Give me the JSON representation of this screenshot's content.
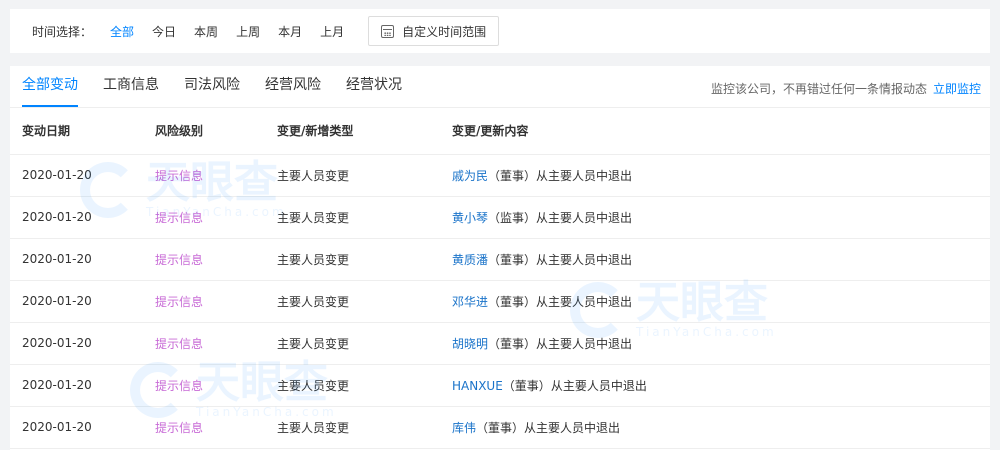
{
  "filter": {
    "label": "时间选择：",
    "options": [
      "全部",
      "今日",
      "本周",
      "上周",
      "本月",
      "上月"
    ],
    "custom_range": "自定义时间范围"
  },
  "tabs": [
    "全部变动",
    "工商信息",
    "司法风险",
    "经营风险",
    "经营状况"
  ],
  "monitor": {
    "text": "监控该公司，不再错过任何一条情报动态",
    "link": "立即监控"
  },
  "table": {
    "headers": [
      "变动日期",
      "风险级别",
      "变更/新增类型",
      "变更/更新内容"
    ],
    "rows": [
      {
        "date": "2020-01-20",
        "risk": "提示信息",
        "type": "主要人员变更",
        "person": "戚为民",
        "role": "（董事）",
        "action": "从主要人员中退出"
      },
      {
        "date": "2020-01-20",
        "risk": "提示信息",
        "type": "主要人员变更",
        "person": "黄小琴",
        "role": "（监事）",
        "action": "从主要人员中退出"
      },
      {
        "date": "2020-01-20",
        "risk": "提示信息",
        "type": "主要人员变更",
        "person": "黄质潘",
        "role": "（董事）",
        "action": "从主要人员中退出"
      },
      {
        "date": "2020-01-20",
        "risk": "提示信息",
        "type": "主要人员变更",
        "person": "邓华进",
        "role": "（董事）",
        "action": "从主要人员中退出"
      },
      {
        "date": "2020-01-20",
        "risk": "提示信息",
        "type": "主要人员变更",
        "person": "胡晓明",
        "role": "（董事）",
        "action": "从主要人员中退出"
      },
      {
        "date": "2020-01-20",
        "risk": "提示信息",
        "type": "主要人员变更",
        "person": "HANXUE",
        "role": "（董事）",
        "action": "从主要人员中退出"
      },
      {
        "date": "2020-01-20",
        "risk": "提示信息",
        "type": "主要人员变更",
        "person": "库伟",
        "role": "（董事）",
        "action": "从主要人员中退出"
      }
    ]
  },
  "watermark": {
    "text": "天眼查",
    "sub": "TianYanCha.com"
  },
  "colors": {
    "accent": "#0084ff",
    "risk_hint": "#c86bd6",
    "link": "#1a73c9"
  }
}
